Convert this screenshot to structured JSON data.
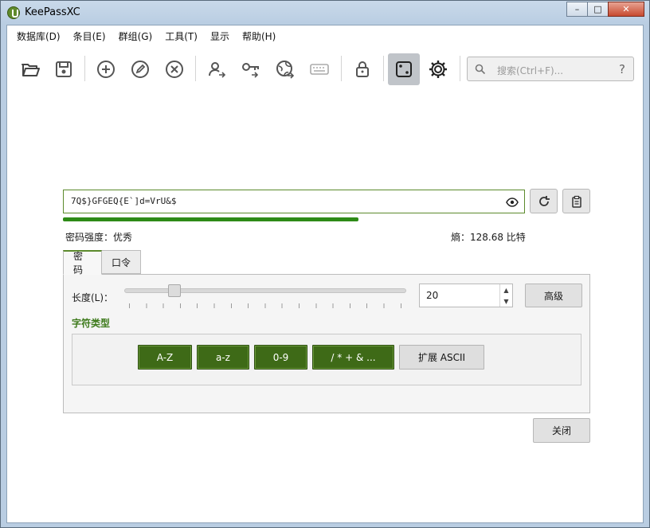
{
  "window": {
    "title": "KeePassXC",
    "controls": [
      "minimize",
      "maximize",
      "close"
    ]
  },
  "menu": [
    "数据库(D)",
    "条目(E)",
    "群组(G)",
    "工具(T)",
    "显示",
    "帮助(H)"
  ],
  "toolbar": {
    "icons": [
      "open-database-icon",
      "save-database-icon",
      "add-entry-icon",
      "edit-entry-icon",
      "delete-entry-icon",
      "copy-username-icon",
      "copy-password-icon",
      "copy-url-icon",
      "autotype-icon",
      "lock-database-icon",
      "password-generator-icon",
      "settings-icon"
    ],
    "active": "password-generator-icon"
  },
  "search": {
    "placeholder": "搜索(Ctrl+F)...",
    "help": "?"
  },
  "generator": {
    "password": "7Q$}GFGEQ{E`]d=VrU&$",
    "strength_label": "密码强度：优秀",
    "entropy_label": "熵：128.68 比特",
    "strength_fraction": 0.64,
    "tabs": [
      "密码",
      "口令"
    ],
    "active_tab": "密码",
    "length_label": "长度(L)：",
    "length_value": "20",
    "length_slider_fraction": 0.16,
    "advanced_label": "高级",
    "char_types_label": "字符类型",
    "char_types": [
      {
        "label": "A-Z",
        "on": true
      },
      {
        "label": "a-z",
        "on": true
      },
      {
        "label": "0-9",
        "on": true
      },
      {
        "label": "/ * + & ...",
        "on": true
      },
      {
        "label": "扩展 ASCII",
        "on": false
      }
    ],
    "close_label": "关闭"
  },
  "colors": {
    "accent": "#5b8a2c",
    "strength": "#2e8b17",
    "char_on": "#3e6a17"
  }
}
